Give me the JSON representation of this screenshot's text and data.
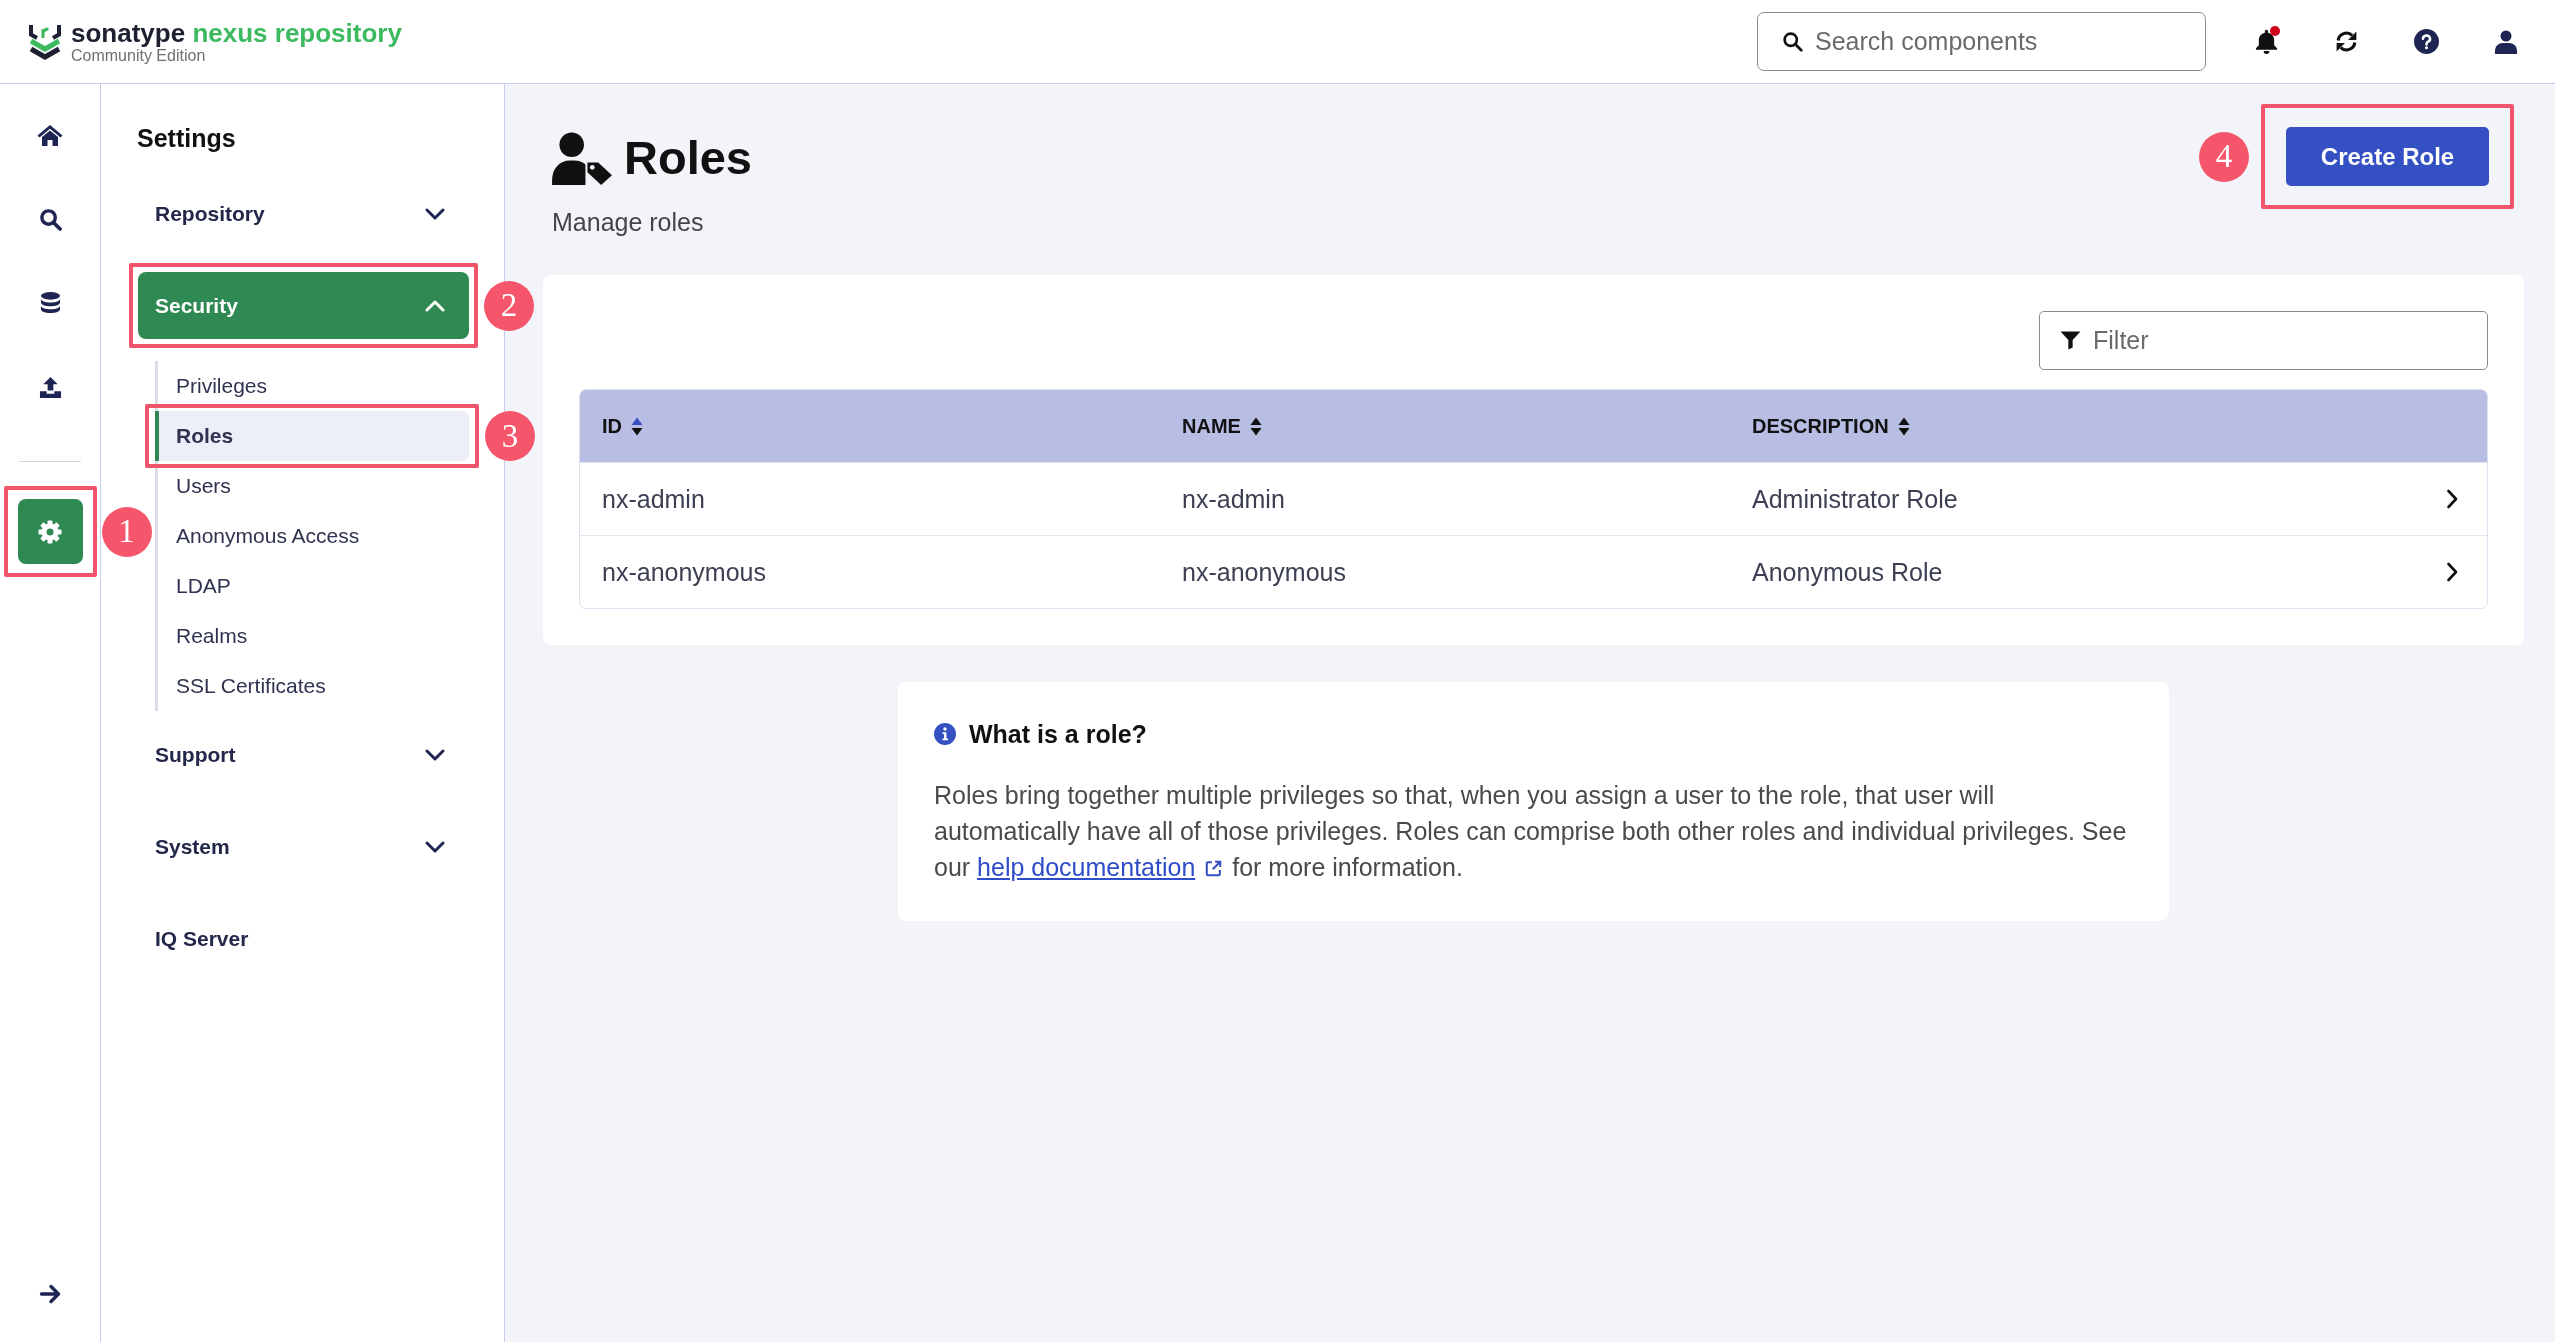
{
  "header": {
    "logo": {
      "brand": "sonatype",
      "product": "nexus repository",
      "edition": "Community Edition"
    },
    "search": {
      "placeholder": "Search components"
    },
    "notifications": {
      "unread": true
    }
  },
  "rail": {
    "items": [
      {
        "selected": false
      },
      {
        "selected": false
      },
      {
        "selected": false
      },
      {
        "selected": false
      }
    ],
    "admin_items": [
      {
        "selected": true,
        "callout": "1"
      }
    ]
  },
  "settings_nav": {
    "title": "Settings",
    "sections": [
      {
        "label": "Repository",
        "selected": false,
        "expanded": false
      },
      {
        "label": "Security",
        "selected": true,
        "expanded": true,
        "callout": "2",
        "children": [
          {
            "label": "Privileges",
            "selected": false
          },
          {
            "label": "Roles",
            "selected": true,
            "callout": "3"
          },
          {
            "label": "Users",
            "selected": false
          },
          {
            "label": "Anonymous Access",
            "selected": false
          },
          {
            "label": "LDAP",
            "selected": false
          },
          {
            "label": "Realms",
            "selected": false
          },
          {
            "label": "SSL Certificates",
            "selected": false
          }
        ]
      },
      {
        "label": "Support",
        "selected": false,
        "expanded": false
      },
      {
        "label": "System",
        "selected": false,
        "expanded": false
      }
    ],
    "links": [
      {
        "label": "IQ Server",
        "selected": false
      }
    ]
  },
  "page": {
    "title": "Roles",
    "subtitle": "Manage roles",
    "create_button": {
      "label": "Create Role",
      "callout": "4"
    },
    "filter": {
      "placeholder": "Filter"
    },
    "table": {
      "columns": [
        {
          "label": "ID",
          "sorted": true
        },
        {
          "label": "NAME",
          "sorted": false
        },
        {
          "label": "DESCRIPTION",
          "sorted": false
        }
      ],
      "rows": [
        {
          "cells": [
            "nx-admin",
            "nx-admin",
            "Administrator Role"
          ]
        },
        {
          "cells": [
            "nx-anonymous",
            "nx-anonymous",
            "Anonymous Role"
          ]
        }
      ]
    },
    "info": {
      "title": "What is a role?",
      "text": "Roles bring together multiple privileges so that, when you assign a user to the role, that user will automatically have all of those privileges. Roles can comprise both other roles and individual privileges. See our",
      "link": "help documentation",
      "text_after": "for more information."
    }
  }
}
